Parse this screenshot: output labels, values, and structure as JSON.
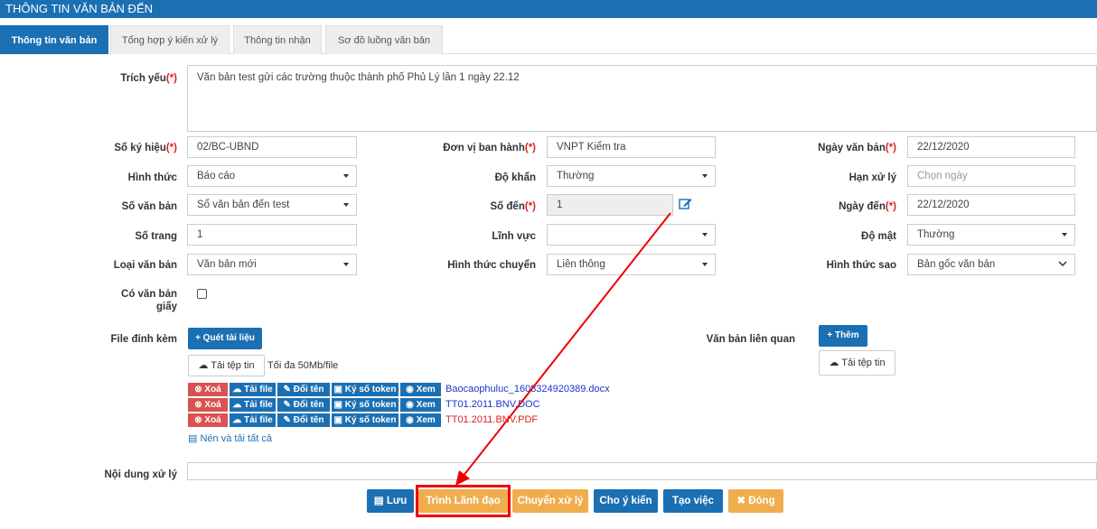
{
  "window_title": "THÔNG TIN VĂN BẢN ĐẾN",
  "tabs": [
    {
      "label": "Thông tin văn bản",
      "active": true
    },
    {
      "label": "Tổng hợp ý kiến xử lý",
      "active": false
    },
    {
      "label": "Thông tin nhận",
      "active": false
    },
    {
      "label": "Sơ đồ luồng văn bản",
      "active": false
    }
  ],
  "required_marker": "(*)",
  "form": {
    "trich_yeu": {
      "label": "Trích yếu",
      "value": "Văn bản test gửi các trường thuộc thành phố Phủ Lý lần 1 ngày 22.12"
    },
    "so_ky_hieu": {
      "label": "Số ký hiệu",
      "value": "02/BC-UBND"
    },
    "don_vi_ban_hanh": {
      "label": "Đơn vị ban hành",
      "value": "VNPT Kiểm tra"
    },
    "ngay_van_ban": {
      "label": "Ngày văn bản",
      "value": "22/12/2020"
    },
    "hinh_thuc": {
      "label": "Hình thức",
      "value": "Báo cáo"
    },
    "do_khan": {
      "label": "Độ khẩn",
      "value": "Thường"
    },
    "han_xu_ly": {
      "label": "Hạn xử lý",
      "placeholder": "Chọn ngày"
    },
    "so_van_ban": {
      "label": "Số văn bản",
      "value": "Sổ văn bản đến test"
    },
    "so_den": {
      "label": "Số đến",
      "value": "1"
    },
    "ngay_den": {
      "label": "Ngày đến",
      "value": "22/12/2020"
    },
    "so_trang": {
      "label": "Số trang",
      "value": "1"
    },
    "linh_vuc": {
      "label": "Lĩnh vực",
      "value": ""
    },
    "do_mat": {
      "label": "Độ mật",
      "value": "Thường"
    },
    "loai_van_ban": {
      "label": "Loại văn bản",
      "value": "Văn bản mới"
    },
    "hinh_thuc_chuyen": {
      "label": "Hình thức chuyển",
      "value": "Liên thông"
    },
    "hinh_thuc_sao": {
      "label": "Hình thức sao",
      "value": "Bản gốc văn bản"
    },
    "co_van_ban_giay": {
      "label_line1": "Có văn bản",
      "label_line2": "giấy",
      "checked": false
    },
    "file_dinh_kem": {
      "label": "File đính kèm"
    },
    "van_ban_lien_quan": {
      "label": "Văn bản liên quan"
    },
    "noi_dung_xu_ly": {
      "label": "Nội dung xử lý"
    }
  },
  "attachments": {
    "scan_button": "+ Quét tài liệu",
    "upload_button": "Tải tệp tin",
    "max_size_note": "Tối đa 50Mb/file",
    "action_labels": {
      "delete": "Xoá",
      "download": "Tải file",
      "rename": "Đổi tên",
      "sign": "Ký số token",
      "view": "Xem"
    },
    "files": [
      {
        "name": "Baocaophuluc_1608324920389.docx",
        "color": "#1a35c8"
      },
      {
        "name": "TT01.2011.BNV.DOC",
        "color": "#1a35c8"
      },
      {
        "name": "TT01.2011.BNV.PDF",
        "color": "#e02020"
      }
    ],
    "compress_all": "Nén và tải tất cả"
  },
  "related": {
    "add_button": "+ Thêm",
    "upload_button": "Tải tệp tin"
  },
  "footer_buttons": [
    {
      "label": "Lưu",
      "style": "blue"
    },
    {
      "label": "Trình Lãnh đạo",
      "style": "orange"
    },
    {
      "label": "Chuyển xử lý",
      "style": "orange"
    },
    {
      "label": "Cho ý kiến",
      "style": "blue"
    },
    {
      "label": "Tạo việc",
      "style": "blue"
    },
    {
      "label": "Đóng",
      "style": "orange"
    }
  ],
  "colors": {
    "primary": "#1b6fb3",
    "warning": "#f0ad4e",
    "danger": "#d9534f",
    "highlight": "#e00000"
  }
}
